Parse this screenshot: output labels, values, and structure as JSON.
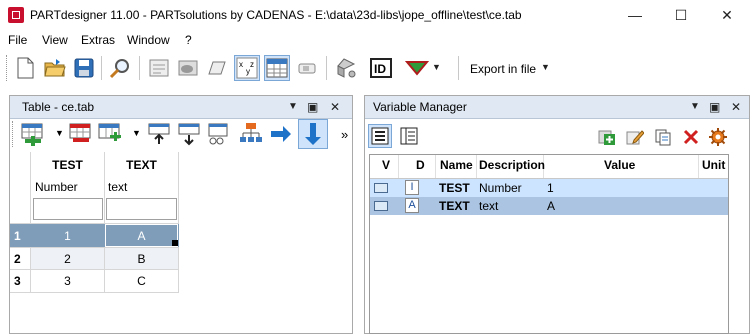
{
  "window": {
    "title": "PARTdesigner 11.00 - PARTsolutions by CADENAS - E:\\data\\23d-libs\\jope_offline\\test\\ce.tab",
    "min_glyph": "—",
    "max_glyph": "☐",
    "close_glyph": "✕"
  },
  "menu": [
    "File",
    "View",
    "Extras",
    "Window",
    "?"
  ],
  "toolbar": {
    "export_label": "Export in file",
    "export_chevron": "▼"
  },
  "table_panel": {
    "title": "Table - ce.tab",
    "more": "»",
    "columns": [
      {
        "name": "TEST",
        "type": "Number"
      },
      {
        "name": "TEXT",
        "type": "text"
      }
    ],
    "rows": [
      {
        "num": "1",
        "values": [
          "1",
          "A"
        ]
      },
      {
        "num": "2",
        "values": [
          "2",
          "B"
        ]
      },
      {
        "num": "3",
        "values": [
          "3",
          "C"
        ]
      }
    ]
  },
  "variable_manager": {
    "title": "Variable Manager",
    "headers": {
      "v": "V",
      "d": "D",
      "name": "Name",
      "description": "Description",
      "value": "Value",
      "unit": "Unit"
    },
    "rows": [
      {
        "name": "TEST",
        "description": "Number",
        "value": "1",
        "type_glyph": "I"
      },
      {
        "name": "TEXT",
        "description": "text",
        "value": "A",
        "type_glyph": "A"
      }
    ]
  },
  "panel_controls": {
    "menu": "▼",
    "float": "▣",
    "close": "✕"
  },
  "colors": {
    "selected_row": "#7f9db9",
    "vm_row_1": "#cce4ff",
    "vm_row_2": "#aac4e2",
    "panel_header": "#dfe8f3",
    "accent_blue": "#1e73c8",
    "accent_green": "#2e9a3a",
    "accent_red": "#d02020"
  }
}
